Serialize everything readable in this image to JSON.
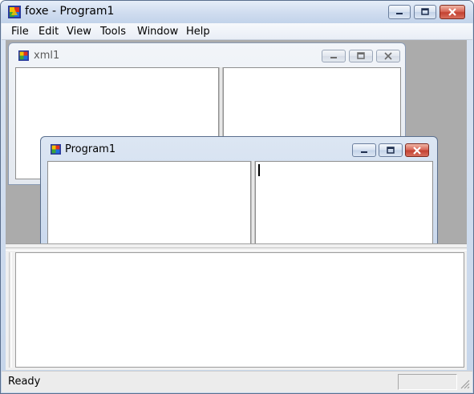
{
  "app": {
    "title": "foxe - Program1"
  },
  "menu": {
    "items": [
      "File",
      "Edit",
      "View",
      "Tools",
      "Window",
      "Help"
    ]
  },
  "windows": {
    "xml1": {
      "title": "xml1"
    },
    "program1": {
      "title": "Program1"
    }
  },
  "status": {
    "text": "Ready"
  },
  "colors": {
    "mdi_background": "#ababab",
    "close_button": "#c34232",
    "title_gradient": "#c5d5ea"
  }
}
